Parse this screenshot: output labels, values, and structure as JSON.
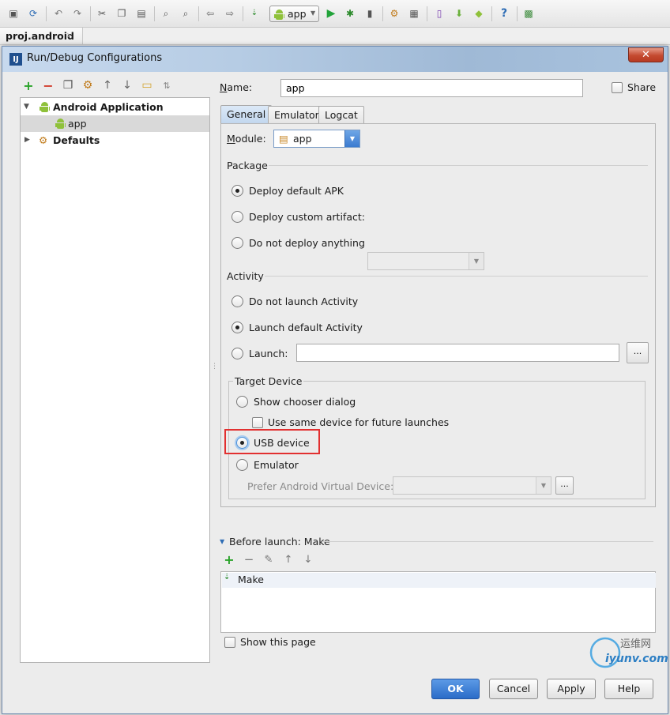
{
  "ide": {
    "run_config": "app",
    "breadcrumb": "proj.android"
  },
  "dialog": {
    "title": "Run/Debug Configurations",
    "close_glyph": "✕"
  },
  "tree": {
    "items": [
      {
        "label": "Android Application",
        "expanded": true
      },
      {
        "label": "app",
        "selected": true
      },
      {
        "label": "Defaults",
        "expanded": false
      }
    ]
  },
  "form": {
    "name_label": "Name:",
    "name_value": "app",
    "share_label": "Share",
    "tabs": [
      "General",
      "Emulator",
      "Logcat"
    ],
    "module_label": "Module:",
    "module_value": "app",
    "package": {
      "title": "Package",
      "options": [
        "Deploy default APK",
        "Deploy custom artifact:",
        "Do not deploy anything"
      ],
      "selected": 0
    },
    "activity": {
      "title": "Activity",
      "options": [
        "Do not launch Activity",
        "Launch default Activity",
        "Launch:"
      ],
      "selected": 1,
      "browse": "..."
    },
    "target": {
      "title": "Target Device",
      "chooser": "Show chooser dialog",
      "same_device": "Use same device for future launches",
      "usb": "USB device",
      "emulator": "Emulator",
      "prefer_avd": "Prefer Android Virtual Device:",
      "selected": "usb",
      "browse": "..."
    },
    "before_launch": {
      "title": "Before launch: Make",
      "items": [
        "Make"
      ]
    },
    "show_page": "Show this page"
  },
  "buttons": {
    "ok": "OK",
    "cancel": "Cancel",
    "apply": "Apply",
    "help": "Help"
  },
  "watermark": "iyunv.com",
  "watermark_cn": "运维网"
}
